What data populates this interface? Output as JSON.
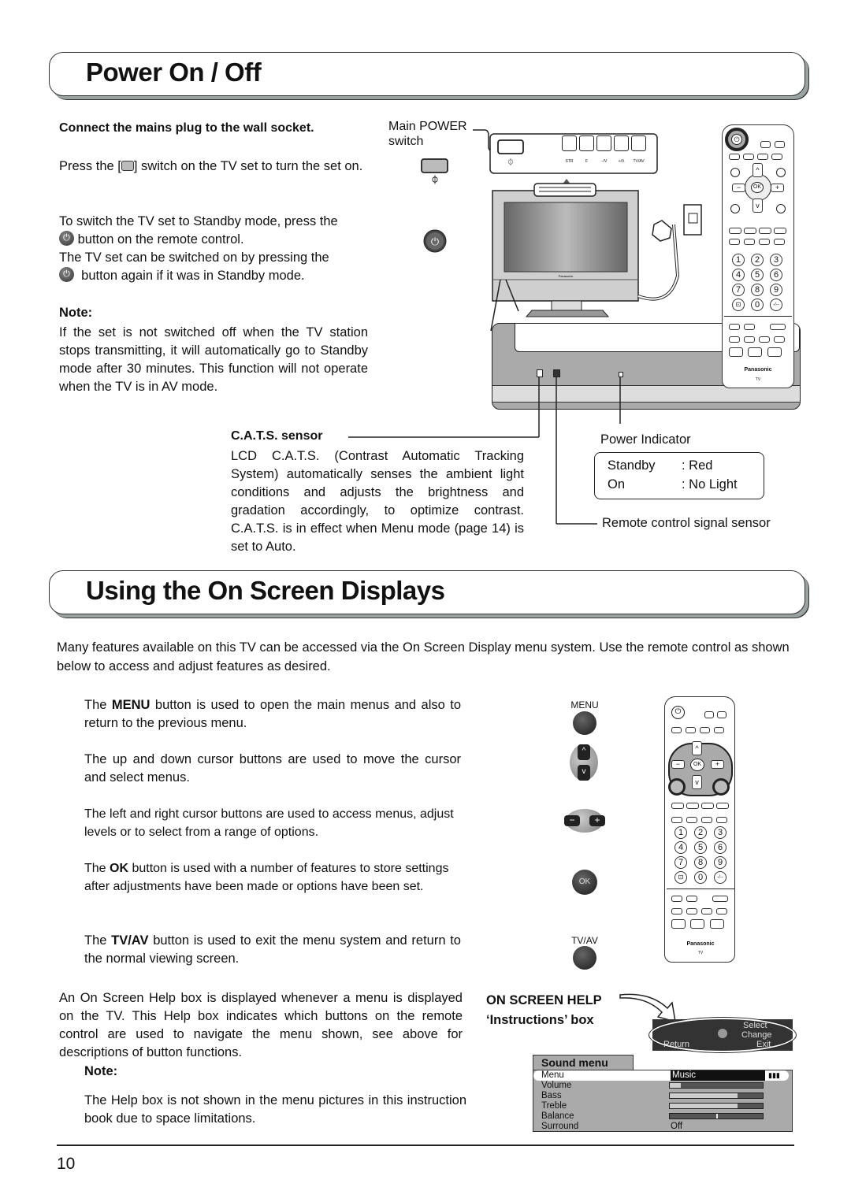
{
  "section1": {
    "title": "Power On / Off",
    "connect_heading": "Connect the mains plug to the wall socket.",
    "press_text_pre": "Press the [",
    "press_text_post": "] switch on the TV set to turn the set on.",
    "standby_line1": "To switch the TV set to Standby mode, press the",
    "standby_line2": "button on the remote control.",
    "switchon_line1": "The TV set can be switched on by pressing the",
    "switchon_line2": "button again if it was in Standby mode.",
    "note_label": "Note:",
    "note_text": "If the set is not switched off when the TV station stops transmitting, it will automatically go to Standby mode after 30 minutes. This function will not operate when the TV is in AV mode.",
    "main_power_label": "Main POWER switch",
    "panel_buttons": [
      "STR",
      "F",
      "−/V",
      "+/Λ",
      "TV/AV"
    ],
    "tv_brand": "Panasonic",
    "cats_heading": "C.A.T.S. sensor",
    "cats_text": "LCD C.A.T.S. (Contrast Automatic Tracking System) automatically senses the ambient light conditions and adjusts the brightness and gradation accordingly, to optimize contrast. C.A.T.S. is in effect when Menu mode (page 14) is set to Auto.",
    "power_indicator_label": "Power Indicator",
    "indicator_rows": [
      {
        "state": "Standby",
        "value": ": Red"
      },
      {
        "state": "On",
        "value": ": No Light"
      }
    ],
    "remote_sensor_label": "Remote control signal sensor"
  },
  "remote": {
    "brand": "Panasonic",
    "sub": "TV",
    "ok": "OK",
    "numbers": [
      "1",
      "2",
      "3",
      "4",
      "5",
      "6",
      "7",
      "8",
      "9",
      "⊡",
      "0",
      "-/--"
    ]
  },
  "section2": {
    "title": "Using the On Screen Displays",
    "intro": "Many features available on this TV can be accessed via the On Screen Display menu system. Use the remote control as shown below to access and adjust features as desired.",
    "items": [
      {
        "pre": "The ",
        "bold": "MENU",
        "post": " button is used to open the main menus and also to return to the previous menu."
      },
      {
        "pre": "",
        "bold": "",
        "post": "The up and down cursor buttons are used to move the cursor and select menus."
      },
      {
        "pre": "",
        "bold": "",
        "post": "The left and right cursor buttons are used to access menus, adjust levels or to select from a range of options."
      },
      {
        "pre": "The ",
        "bold": "OK",
        "post": " button is used with a number of features to store settings after adjustments have been made or options have been set."
      },
      {
        "pre": "The ",
        "bold": "TV/AV",
        "post": " button is used to exit the menu system and return to the normal viewing screen."
      }
    ],
    "menu_btn_label": "MENU",
    "ok_btn_label": "OK",
    "tvav_btn_label": "TV/AV",
    "help_text": "An On Screen Help box is displayed whenever a menu is displayed on the TV. This Help box indicates which buttons on the remote control are used to navigate the menu shown, see above for descriptions of button functions.",
    "note_label": "Note:",
    "note_text": "The Help box is not shown in the menu pictures in this instruction book due to space limitations.",
    "osh_title_line1": "ON SCREEN HELP",
    "osh_title_line2": "‘Instructions’ box",
    "help_box": {
      "select": "Select",
      "change": "Change",
      "return": "Return",
      "exit": "Exit"
    },
    "sound_menu": {
      "title": "Sound menu",
      "rows": [
        {
          "label": "Menu",
          "value": "Music",
          "type": "text",
          "selected": true
        },
        {
          "label": "Volume",
          "type": "bar",
          "level": 0.12
        },
        {
          "label": "Bass",
          "type": "bar",
          "level": 0.73
        },
        {
          "label": "Treble",
          "type": "bar",
          "level": 0.73
        },
        {
          "label": "Balance",
          "type": "balance",
          "level": 0.5
        },
        {
          "label": "Surround",
          "value": "Off",
          "type": "text"
        }
      ]
    }
  },
  "footer": {
    "page_number": "10"
  }
}
